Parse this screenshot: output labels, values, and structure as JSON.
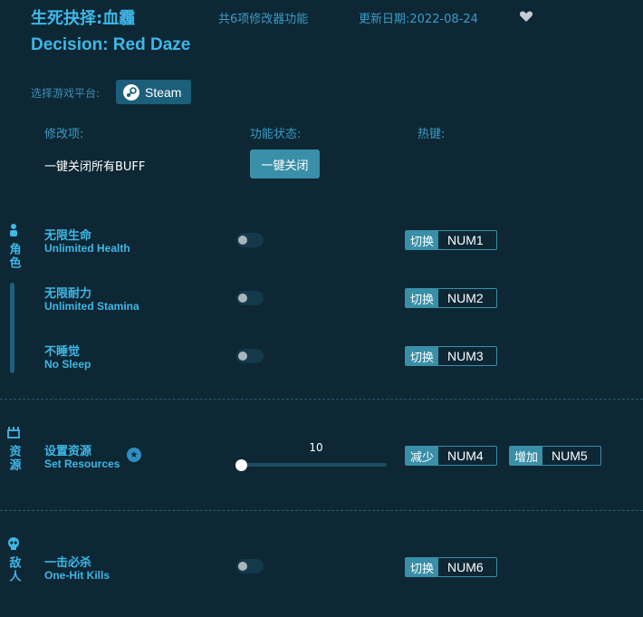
{
  "header": {
    "title_cn": "生死抉择:血霾",
    "count_text": "共6项修改器功能",
    "update_text": "更新日期:2022-08-24",
    "title_en": "Decision: Red Daze"
  },
  "platform": {
    "label": "选择游戏平台:",
    "selected": "Steam"
  },
  "columns": {
    "item": "修改项:",
    "status": "功能状态:",
    "hotkey": "热键:"
  },
  "global": {
    "label": "一键关闭所有BUFF",
    "button": "一键关闭"
  },
  "categories": [
    {
      "name": "角色",
      "icon": "person-icon"
    },
    {
      "name": "资源",
      "icon": "resources-icon"
    },
    {
      "name": "敌人",
      "icon": "skull-icon"
    }
  ],
  "items": [
    {
      "cn": "无限生命",
      "en": "Unlimited Health",
      "enabled": false,
      "action": "切换",
      "key": "NUM1"
    },
    {
      "cn": "无限耐力",
      "en": "Unlimited Stamina",
      "enabled": false,
      "action": "切换",
      "key": "NUM2"
    },
    {
      "cn": "不睡觉",
      "en": "No Sleep",
      "enabled": false,
      "action": "切换",
      "key": "NUM3"
    },
    {
      "cn": "设置资源",
      "en": "Set Resources",
      "slider_value": "10",
      "slider_fraction": 0.0,
      "action": "减少",
      "key": "NUM4",
      "action2": "增加",
      "key2": "NUM5"
    },
    {
      "cn": "一击必杀",
      "en": "One-Hit Kills",
      "enabled": false,
      "action": "切换",
      "key": "NUM6"
    }
  ],
  "colors": {
    "background": "#0d2735",
    "accent": "#3fb7e6",
    "button": "#3a8fa8"
  }
}
